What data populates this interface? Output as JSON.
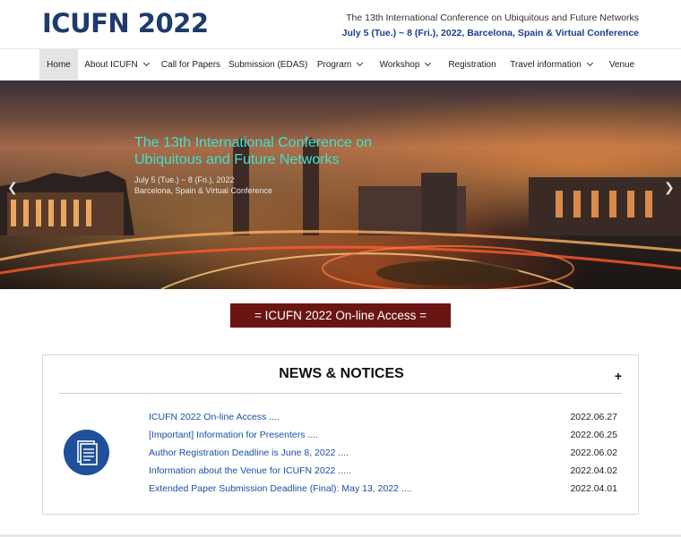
{
  "header": {
    "logo": "ICUFN 2022",
    "tagline_line1": "The 13th International Conference on Ubiquitous and Future Networks",
    "tagline_line2": "July 5 (Tue.) ~ 8 (Fri.), 2022, Barcelona, Spain & Virtual Conference"
  },
  "nav": {
    "items": [
      {
        "label": "Home",
        "active": true
      },
      {
        "label": "About ICUFN",
        "dropdown": true
      },
      {
        "label": "Call for Papers"
      },
      {
        "label": "Submission (EDAS)"
      },
      {
        "label": "Program",
        "dropdown": true
      },
      {
        "label": "Workshop",
        "dropdown": true
      },
      {
        "label": "Registration"
      },
      {
        "label": "Travel information",
        "dropdown": true
      },
      {
        "label": "Venue"
      }
    ]
  },
  "hero": {
    "title": "The 13th International Conference on Ubiquitous and Future Networks",
    "date": "July 5 (Tue.) ~ 8 (Fri.), 2022",
    "location": "Barcelona, Spain & Virtual Conference",
    "prev_icon": "chevron-left-icon",
    "next_icon": "chevron-right-icon"
  },
  "access_button": "= ICUFN 2022 On-line Access =",
  "news": {
    "title": "NEWS & NOTICES",
    "more": "+",
    "icon": "document-icon",
    "items": [
      {
        "title": "ICUFN 2022 On-line Access ....",
        "date": "2022.06.27"
      },
      {
        "title": "[Important] Information for Presenters ....",
        "date": "2022.06.25"
      },
      {
        "title": "Author Registration Deadline is June 8, 2022 ....",
        "date": "2022.06.02"
      },
      {
        "title": "Information about the Venue for ICUFN 2022 .....",
        "date": "2022.04.02"
      },
      {
        "title": "Extended Paper Submission Deadline (Final): May 13, 2022 ....",
        "date": "2022.04.01"
      }
    ]
  },
  "colors": {
    "logo": "#1f3a6b",
    "accent_blue": "#1a3d8f",
    "hero_title": "#3fe0d0",
    "access_button_bg": "#6b1414",
    "news_link": "#1a4fa3",
    "news_icon_bg": "#1f4e9a"
  }
}
